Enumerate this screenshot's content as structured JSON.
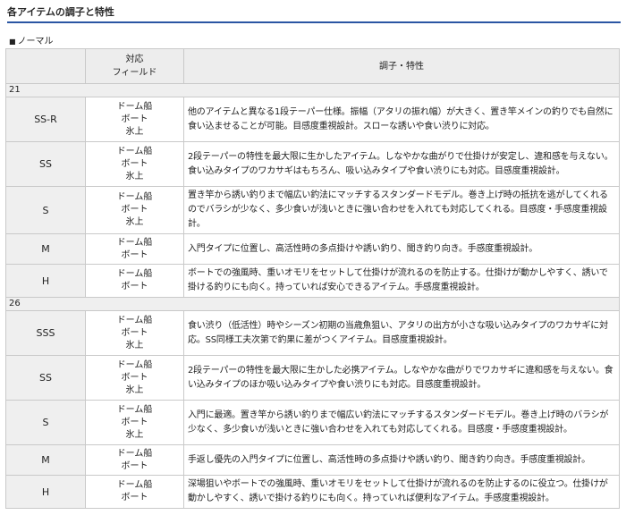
{
  "title": "各アイテムの調子と特性",
  "section": {
    "bullet": "■",
    "label": "ノーマル"
  },
  "header": {
    "field_line1": "対応",
    "field_line2": "フィールド",
    "desc": "調子・特性"
  },
  "groups": [
    {
      "label": "21",
      "items": [
        {
          "name": "SS-R",
          "fields": [
            "ドーム船",
            "ボート",
            "氷上"
          ],
          "desc": "他のアイテムと異なる1段テーパー仕様。振幅（アタリの振れ幅）が大きく、置き竿メインの釣りでも自然に食い込ませることが可能。目感度重視設計。スローな誘いや食い渋りに対応。"
        },
        {
          "name": "SS",
          "fields": [
            "ドーム船",
            "ボート",
            "氷上"
          ],
          "desc": "2段テーパーの特性を最大限に生かしたアイテム。しなやかな曲がりで仕掛けが安定し、違和感を与えない。食い込みタイプのワカサギはもちろん、吸い込みタイプや食い渋りにも対応。目感度重視設計。"
        },
        {
          "name": "S",
          "fields": [
            "ドーム船",
            "ボート",
            "氷上"
          ],
          "desc": "置き竿から誘い釣りまで幅広い釣法にマッチするスタンダードモデル。巻き上げ時の抵抗を逃がしてくれるのでバラシが少なく、多少食いが浅いときに強い合わせを入れても対応してくれる。目感度・手感度重視設計。"
        },
        {
          "name": "M",
          "fields": [
            "ドーム船",
            "ボート"
          ],
          "desc": "入門タイプに位置し、高活性時の多点掛けや誘い釣り、聞き釣り向き。手感度重視設計。"
        },
        {
          "name": "H",
          "fields": [
            "ドーム船",
            "ボート"
          ],
          "desc": "ボートでの強風時、重いオモリをセットして仕掛けが流れるのを防止する。仕掛けが動かしやすく、誘いで掛ける釣りにも向く。持っていれば安心できるアイテム。手感度重視設計。"
        }
      ]
    },
    {
      "label": "26",
      "items": [
        {
          "name": "SSS",
          "fields": [
            "ドーム船",
            "ボート",
            "氷上"
          ],
          "desc": "食い渋り（低活性）時やシーズン初期の当歳魚狙い、アタリの出方が小さな吸い込みタイプのワカサギに対応。SS同様工夫次第で釣果に差がつくアイテム。目感度重視設計。"
        },
        {
          "name": "SS",
          "fields": [
            "ドーム船",
            "ボート",
            "氷上"
          ],
          "desc": "2段テーパーの特性を最大限に生かした必携アイテム。しなやかな曲がりでワカサギに違和感を与えない。食い込みタイプのほか吸い込みタイプや食い渋りにも対応。目感度重視設計。"
        },
        {
          "name": "S",
          "fields": [
            "ドーム船",
            "ボート",
            "氷上"
          ],
          "desc": "入門に最適。置き竿から誘い釣りまで幅広い釣法にマッチするスタンダードモデル。巻き上げ時のバラシが少なく、多少食いが浅いときに強い合わせを入れても対応してくれる。目感度・手感度重視設計。"
        },
        {
          "name": "M",
          "fields": [
            "ドーム船",
            "ボート"
          ],
          "desc": "手返し優先の入門タイプに位置し、高活性時の多点掛けや誘い釣り、聞き釣り向き。手感度重視設計。"
        },
        {
          "name": "H",
          "fields": [
            "ドーム船",
            "ボート"
          ],
          "desc": "深場狙いやボートでの強風時、重いオモリをセットして仕掛けが流れるのを防止するのに役立つ。仕掛けが動かしやすく、誘いで掛ける釣りにも向く。持っていれば便利なアイテム。手感度重視設計。"
        }
      ]
    }
  ]
}
